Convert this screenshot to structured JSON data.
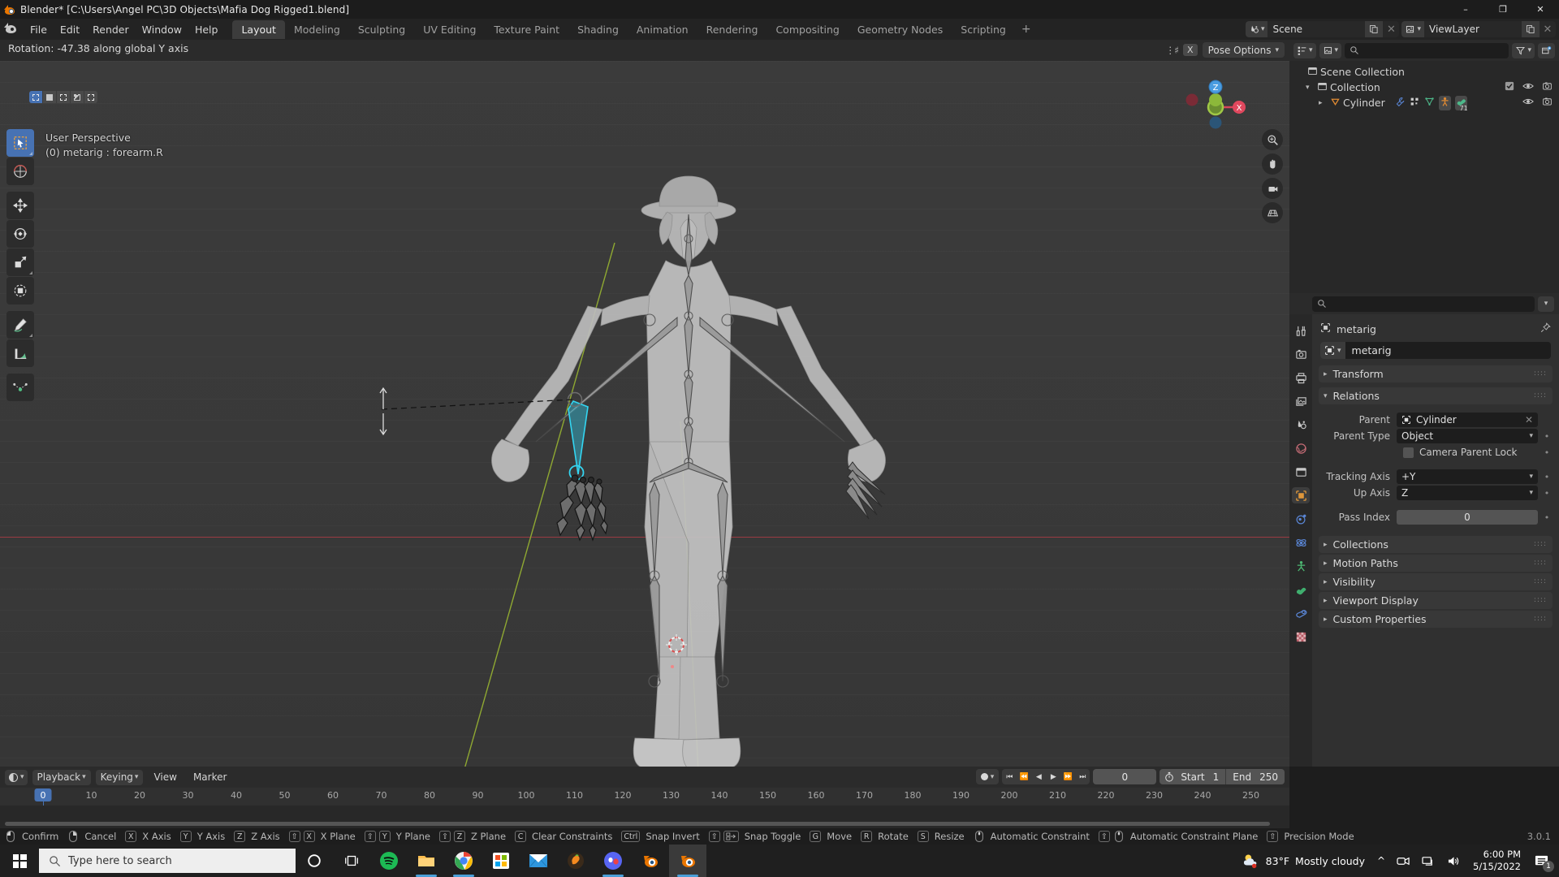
{
  "window": {
    "title": "Blender* [C:\\Users\\Angel PC\\3D Objects\\Mafia Dog Rigged1.blend]",
    "minimize": "–",
    "maximize": "❐",
    "close": "✕"
  },
  "topbar": {
    "menus": [
      "File",
      "Edit",
      "Render",
      "Window",
      "Help"
    ],
    "workspaces": [
      {
        "label": "Layout",
        "active": true
      },
      {
        "label": "Modeling",
        "active": false
      },
      {
        "label": "Sculpting",
        "active": false
      },
      {
        "label": "UV Editing",
        "active": false
      },
      {
        "label": "Texture Paint",
        "active": false
      },
      {
        "label": "Shading",
        "active": false
      },
      {
        "label": "Animation",
        "active": false
      },
      {
        "label": "Rendering",
        "active": false
      },
      {
        "label": "Compositing",
        "active": false
      },
      {
        "label": "Geometry Nodes",
        "active": false
      },
      {
        "label": "Scripting",
        "active": false
      }
    ],
    "add_workspace": "+",
    "scene_name": "Scene",
    "viewlayer_name": "ViewLayer"
  },
  "viewport": {
    "status_text": "Rotation: -47.38 along global Y axis",
    "perspective_label": "User Perspective",
    "object_label": "(0) metarig : forearm.R",
    "pose_options_label": "Pose Options",
    "header_x_label": "X",
    "tools": [
      "tweak-tool",
      "cursor-tool",
      "move-tool",
      "rotate-tool",
      "scale-tool",
      "transform-tool",
      "annotate-tool",
      "measure-tool",
      "add-primitive-tool"
    ],
    "gizmo_axes": [
      "Z",
      "X",
      "Y"
    ],
    "nav_buttons": [
      "zoom-icon",
      "pan-icon",
      "camera-icon",
      "ortho-icon"
    ]
  },
  "outliner": {
    "search_placeholder": "",
    "rows": [
      {
        "name": "Scene Collection",
        "indent": 0,
        "disclosure": "",
        "icon": "collection-icon"
      },
      {
        "name": "Collection",
        "indent": 1,
        "disclosure": "▾",
        "icon": "collection-icon"
      },
      {
        "name": "Cylinder",
        "indent": 2,
        "disclosure": "▸",
        "icon": "mesh-icon"
      }
    ],
    "cylinder_badge": "71"
  },
  "properties": {
    "breadcrumb": "metarig",
    "id_name": "metarig",
    "panels": [
      {
        "label": "Transform",
        "open": false
      },
      {
        "label": "Relations",
        "open": true
      },
      {
        "label": "Collections",
        "open": false
      },
      {
        "label": "Motion Paths",
        "open": false
      },
      {
        "label": "Visibility",
        "open": false
      },
      {
        "label": "Viewport Display",
        "open": false
      },
      {
        "label": "Custom Properties",
        "open": false
      }
    ],
    "relations": {
      "parent_label": "Parent",
      "parent_value": "Cylinder",
      "parent_type_label": "Parent Type",
      "parent_type_value": "Object",
      "camera_parent_lock_label": "Camera Parent Lock",
      "tracking_axis_label": "Tracking Axis",
      "tracking_axis_value": "+Y",
      "up_axis_label": "Up Axis",
      "up_axis_value": "Z",
      "pass_index_label": "Pass Index",
      "pass_index_value": "0"
    }
  },
  "timeline": {
    "menus": [
      "Playback",
      "Keying",
      "View",
      "Marker"
    ],
    "current_frame": "0",
    "start_label": "Start",
    "start_value": "1",
    "end_label": "End",
    "end_value": "250",
    "ticks": [
      "0",
      "10",
      "20",
      "30",
      "40",
      "50",
      "60",
      "70",
      "80",
      "90",
      "100",
      "110",
      "120",
      "130",
      "140",
      "150",
      "160",
      "170",
      "180",
      "190",
      "200",
      "210",
      "220",
      "230",
      "240",
      "250"
    ],
    "playhead_frame": "0"
  },
  "statusbar": {
    "items": [
      {
        "keys": [
          "mouse-left"
        ],
        "label": "Confirm"
      },
      {
        "keys": [
          "mouse-right"
        ],
        "label": "Cancel"
      },
      {
        "keys": [
          "X"
        ],
        "label": "X Axis"
      },
      {
        "keys": [
          "Y"
        ],
        "label": "Y Axis"
      },
      {
        "keys": [
          "Z"
        ],
        "label": "Z Axis"
      },
      {
        "keys": [
          "⇧",
          "X"
        ],
        "label": "X Plane"
      },
      {
        "keys": [
          "⇧",
          "Y"
        ],
        "label": "Y Plane"
      },
      {
        "keys": [
          "⇧",
          "Z"
        ],
        "label": "Z Plane"
      },
      {
        "keys": [
          "C"
        ],
        "label": "Clear Constraints"
      },
      {
        "keys": [
          "Ctrl"
        ],
        "label": "Snap Invert"
      },
      {
        "keys": [
          "⇧",
          "snap"
        ],
        "label": "Snap Toggle"
      },
      {
        "keys": [
          "G"
        ],
        "label": "Move"
      },
      {
        "keys": [
          "R"
        ],
        "label": "Rotate"
      },
      {
        "keys": [
          "S"
        ],
        "label": "Resize"
      },
      {
        "keys": [
          "mouse-mid"
        ],
        "label": "Automatic Constraint"
      },
      {
        "keys": [
          "⇧",
          "mouse-mid"
        ],
        "label": "Automatic Constraint Plane"
      },
      {
        "keys": [
          "⇧"
        ],
        "label": "Precision Mode"
      }
    ],
    "version": "3.0.1"
  },
  "taskbar": {
    "search_placeholder": "Type here to search",
    "apps": [
      {
        "name": "cortana-icon"
      },
      {
        "name": "task-view-icon"
      },
      {
        "name": "spotify-icon"
      },
      {
        "name": "file-explorer-icon"
      },
      {
        "name": "chrome-icon"
      },
      {
        "name": "microsoft-store-icon"
      },
      {
        "name": "mail-icon"
      },
      {
        "name": "fl-studio-icon"
      },
      {
        "name": "discord-icon"
      },
      {
        "name": "blender-icon"
      },
      {
        "name": "blender-icon-active"
      }
    ],
    "weather_temp": "83°F",
    "weather_desc": "Mostly cloudy",
    "time": "6:00 PM",
    "date": "5/15/2022",
    "notification_count": "1"
  }
}
